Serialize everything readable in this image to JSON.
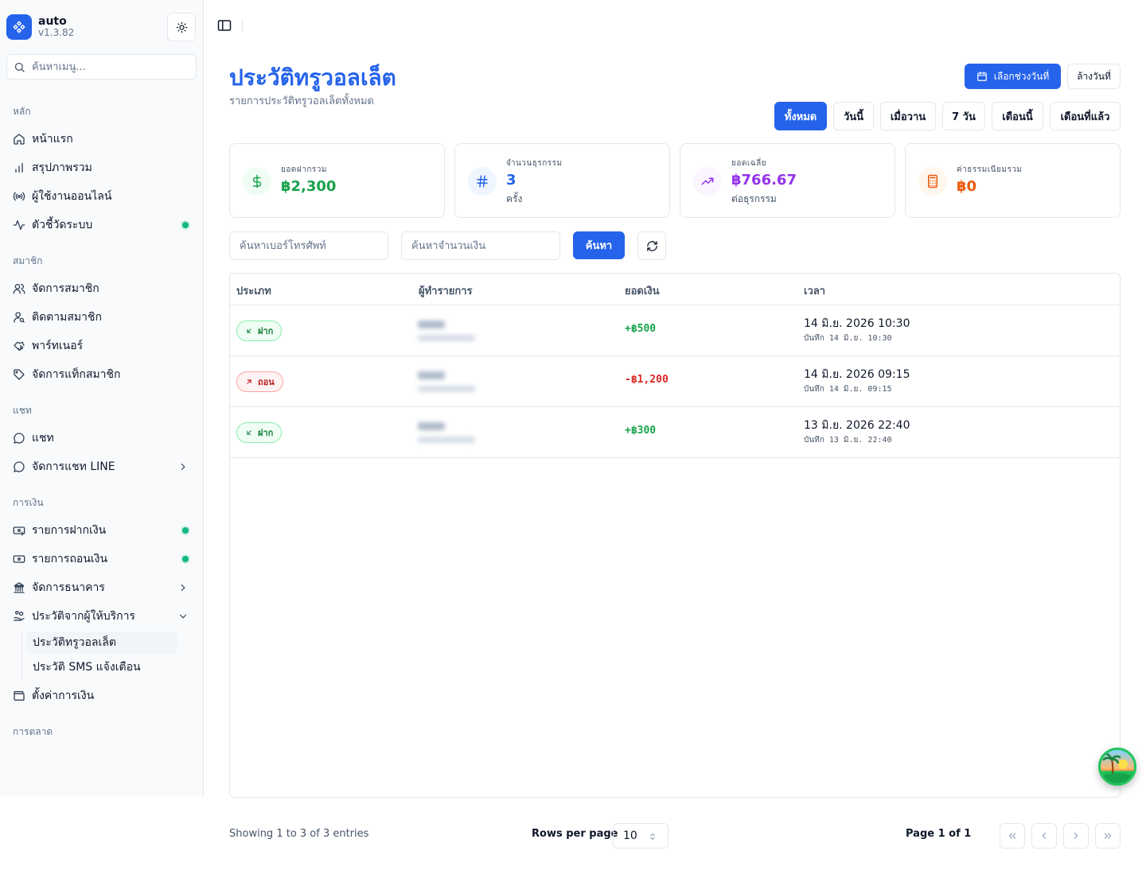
{
  "app": {
    "name": "auto",
    "version": "v1.3.82"
  },
  "sidebar": {
    "search_placeholder": "ค้นหาเมนู...",
    "groups": {
      "main": "หลัก",
      "members": "สมาชิก",
      "chat": "แชท",
      "finance": "การเงิน",
      "marketing": "การตลาด"
    },
    "items": {
      "home": "หน้าแรก",
      "summary": "สรุปภาพรวม",
      "online_users": "ผู้ใช้งานออนไลน์",
      "system_metrics": "ตัวชี้วัดระบบ",
      "manage_members": "จัดการสมาชิก",
      "follow_members": "ติดตามสมาชิก",
      "partners": "พาร์ทเนอร์",
      "member_tags": "จัดการแท็กสมาชิก",
      "chat": "แชท",
      "line_chat": "จัดการแชท LINE",
      "deposits": "รายการฝากเงิน",
      "withdrawals": "รายการถอนเงิน",
      "banks": "จัดการธนาคาร",
      "provider_history": "ประวัติจากผู้ให้บริการ",
      "truewallet_history": "ประวัติทรูวอลเล็ต",
      "sms_history": "ประวัติ SMS แจ้งเตือน",
      "finance_settings": "ตั้งค่าการเงิน"
    }
  },
  "header": {
    "title": "ประวัติทรูวอลเล็ต",
    "subtitle": "รายการประวัติทรูวอลเล็ตทั้งหมด",
    "pick_date": "เลือกช่วงวันที่",
    "clear_date": "ล้างวันที่",
    "ranges": [
      "ทั้งหมด",
      "วันนี้",
      "เมื่อวาน",
      "7 วัน",
      "เดือนนี้",
      "เดือนที่แล้ว"
    ],
    "active_range": "ทั้งหมด"
  },
  "stats": {
    "deposit_total": {
      "label": "ยอดฝากรวม",
      "value": "฿2,300"
    },
    "tx_count": {
      "label": "จำนวนธุรกรรม",
      "value": "3",
      "sub": "ครั้ง"
    },
    "average": {
      "label": "ยอดเฉลี่ย",
      "value": "฿766.67",
      "sub": "ต่อธุรกรรม"
    },
    "fee_total": {
      "label": "ค่าธรรมเนียมรวม",
      "value": "฿0"
    }
  },
  "filters": {
    "phone_placeholder": "ค้นหาเบอร์โทรศัพท์",
    "amount_placeholder": "ค้นหาจำนวนเงิน",
    "search": "ค้นหา"
  },
  "table": {
    "headers": [
      "ประเภท",
      "ผู้ทำรายการ",
      "ยอดเงิน",
      "เวลา"
    ],
    "rows": [
      {
        "type": "ฝาก",
        "amount": "+฿500",
        "time": "14 มิ.ย. 2026 10:30",
        "recorded": "บันทึก 14 มิ.ย. 10:30"
      },
      {
        "type": "ถอน",
        "amount": "-฿1,200",
        "time": "14 มิ.ย. 2026 09:15",
        "recorded": "บันทึก 14 มิ.ย. 09:15"
      },
      {
        "type": "ฝาก",
        "amount": "+฿300",
        "time": "13 มิ.ย. 2026 22:40",
        "recorded": "บันทึก 13 มิ.ย. 22:40"
      }
    ]
  },
  "pagination": {
    "showing": "Showing 1 to 3 of 3 entries",
    "rows_per_page_label": "Rows per page",
    "rows_per_page": "10",
    "page_info": "Page 1 of 1"
  },
  "colors": {
    "accent": "#2563eb",
    "deposit": "#16a34a",
    "withdraw": "#dc2626",
    "average": "#9333ea",
    "fee": "#ea580c",
    "online_dot": "#10b981"
  }
}
